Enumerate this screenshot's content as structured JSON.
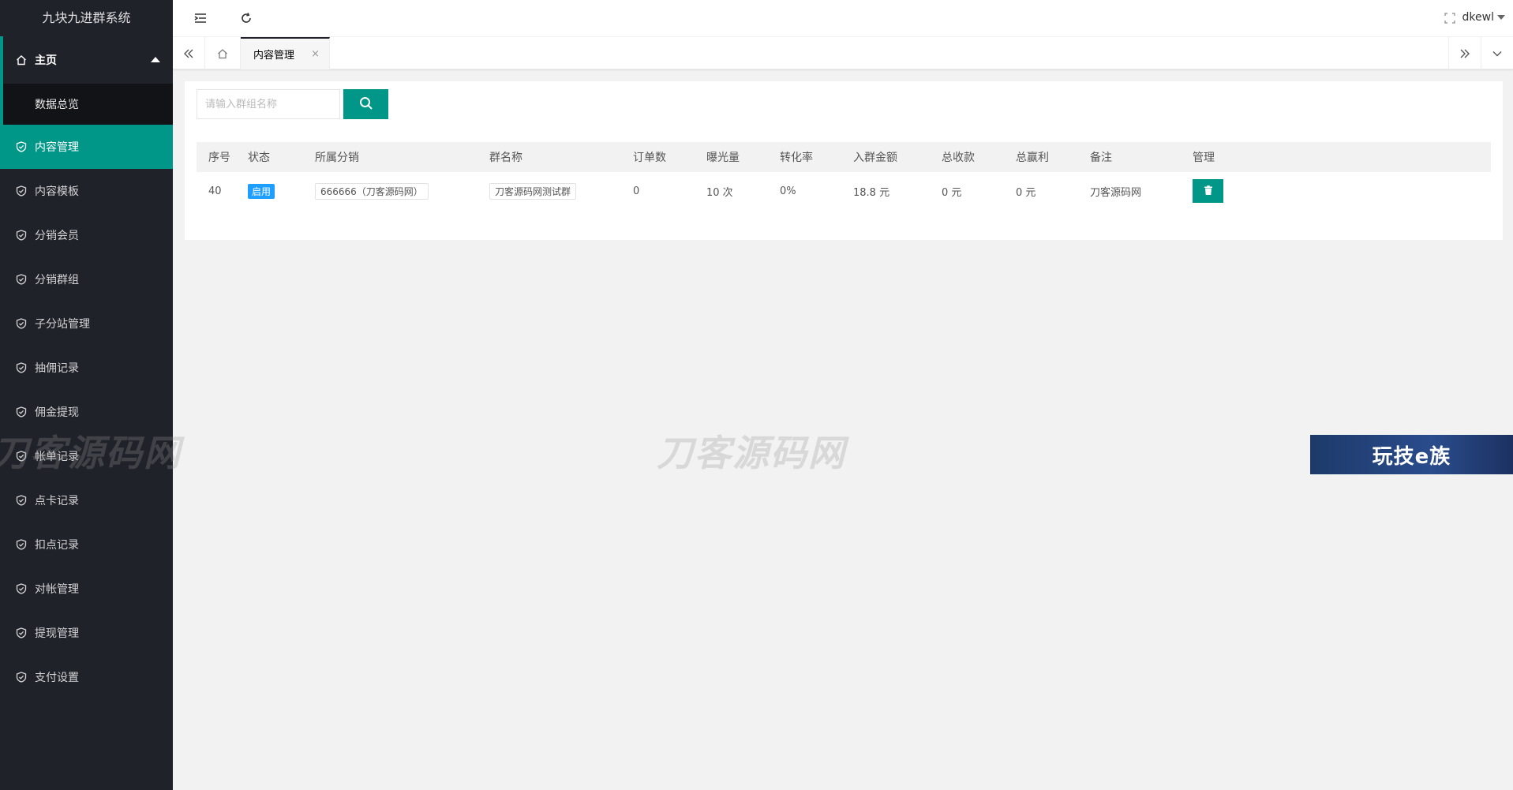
{
  "app": {
    "title": "九块九进群系统"
  },
  "sidebar": {
    "home": {
      "label": "主页",
      "icon": "home-icon"
    },
    "home_child": {
      "label": "数据总览"
    },
    "items": [
      {
        "label": "内容管理",
        "active": true
      },
      {
        "label": "内容模板"
      },
      {
        "label": "分销会员"
      },
      {
        "label": "分销群组"
      },
      {
        "label": "子分站管理"
      },
      {
        "label": "抽佣记录"
      },
      {
        "label": "佣金提现"
      },
      {
        "label": "帐单记录"
      },
      {
        "label": "点卡记录"
      },
      {
        "label": "扣点记录"
      },
      {
        "label": "对帐管理"
      },
      {
        "label": "提现管理"
      },
      {
        "label": "支付设置"
      }
    ]
  },
  "header": {
    "user": "dkewl"
  },
  "tabs": {
    "active_tab": "内容管理",
    "close": "×"
  },
  "search": {
    "placeholder": "请输入群组名称"
  },
  "table": {
    "headers": [
      "序号",
      "状态",
      "所属分销",
      "群名称",
      "订单数",
      "曝光量",
      "转化率",
      "入群金额",
      "总收款",
      "总赢利",
      "备注",
      "管理"
    ],
    "rows": [
      {
        "id": "40",
        "status": "启用",
        "distributor": "666666（刀客源码网）",
        "group_name": "刀客源码网测试群",
        "orders": "0",
        "exposure": "10 次",
        "conversion": "0%",
        "join_amount": "18.8 元",
        "total_received": "0 元",
        "total_profit": "0 元",
        "remark": "刀客源码网"
      }
    ]
  },
  "watermarks": {
    "main": "刀客源码网",
    "ad": "玩技e族"
  },
  "colors": {
    "accent": "#009688",
    "sidebar_bg": "#20222a",
    "badge_blue": "#1e9fff"
  }
}
